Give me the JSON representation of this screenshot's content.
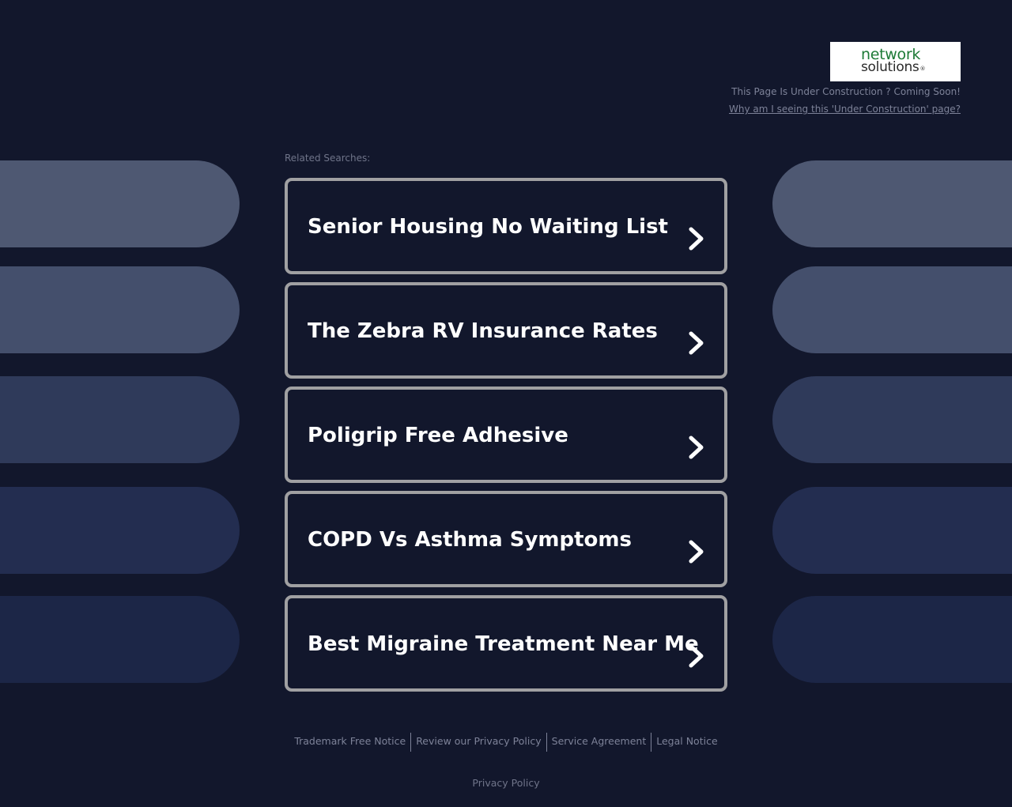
{
  "logo": {
    "line1": "network",
    "line2": "solutions",
    "mark": "®"
  },
  "header": {
    "construction_text": "This Page Is Under Construction ? Coming Soon!",
    "why_link": "Why am I seeing this 'Under Construction' page?"
  },
  "related": {
    "label": "Related Searches:",
    "items": [
      {
        "label": "Senior Housing No Waiting List"
      },
      {
        "label": "The Zebra RV Insurance Rates"
      },
      {
        "label": "Poligrip Free Adhesive"
      },
      {
        "label": "COPD Vs Asthma Symptoms"
      },
      {
        "label": "Best Migraine Treatment Near Me"
      }
    ]
  },
  "decor": {
    "pill_colors": [
      "#4e5872",
      "#444f6c",
      "#2f3a5a",
      "#232d50",
      "#1c2647"
    ]
  },
  "footer": {
    "links": [
      "Trademark Free Notice",
      "Review our Privacy Policy",
      "Service Agreement",
      "Legal Notice"
    ],
    "privacy": "Privacy Policy"
  },
  "colors": {
    "background": "#12172c",
    "card_border": "#a0a0a2",
    "muted_text": "#7d8298",
    "logo_green": "#1d7a36"
  }
}
